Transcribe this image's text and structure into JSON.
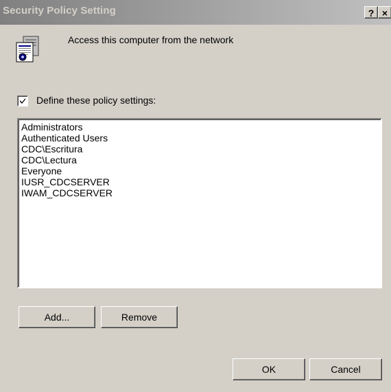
{
  "window": {
    "title": "Security Policy Setting",
    "help_label": "?",
    "close_label": "×"
  },
  "policy": {
    "name": "Access this computer from the network",
    "icon": "policy-document-icon"
  },
  "define": {
    "label": "Define these policy settings:",
    "checked": true
  },
  "principals": [
    "Administrators",
    "Authenticated Users",
    "CDC\\Escritura",
    "CDC\\Lectura",
    "Everyone",
    "IUSR_CDCSERVER",
    "IWAM_CDCSERVER"
  ],
  "buttons": {
    "add": "Add...",
    "remove": "Remove",
    "ok": "OK",
    "cancel": "Cancel"
  },
  "colors": {
    "face": "#d4d0c8",
    "titlebar_inactive": "#808080"
  }
}
